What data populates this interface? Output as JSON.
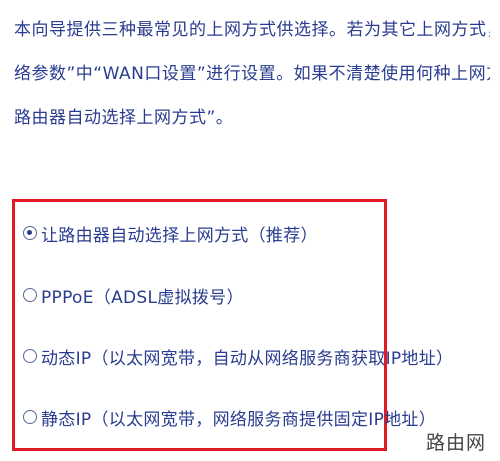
{
  "intro": {
    "lines": [
      "本向导提供三种最常见的上网方式供选择。若为其它上网方式，请点击左侧“",
      "络参数”中“WAN口设置”进行设置。如果不清楚使用何种上网方式，请选择“",
      "路由器自动选择上网方式”。"
    ]
  },
  "options": [
    {
      "label": "让路由器自动选择上网方式（推荐）",
      "selected": true
    },
    {
      "label": "PPPoE（ADSL虚拟拨号）",
      "selected": false
    },
    {
      "label": "动态IP（以太网宽带，自动从网络服务商获取IP地址）",
      "selected": false
    },
    {
      "label": "静态IP（以太网宽带，网络服务商提供固定IP地址）",
      "selected": false
    }
  ],
  "watermark": "路由网",
  "colors": {
    "text": "#2a3c8f",
    "highlight_border": "#e01b24"
  }
}
